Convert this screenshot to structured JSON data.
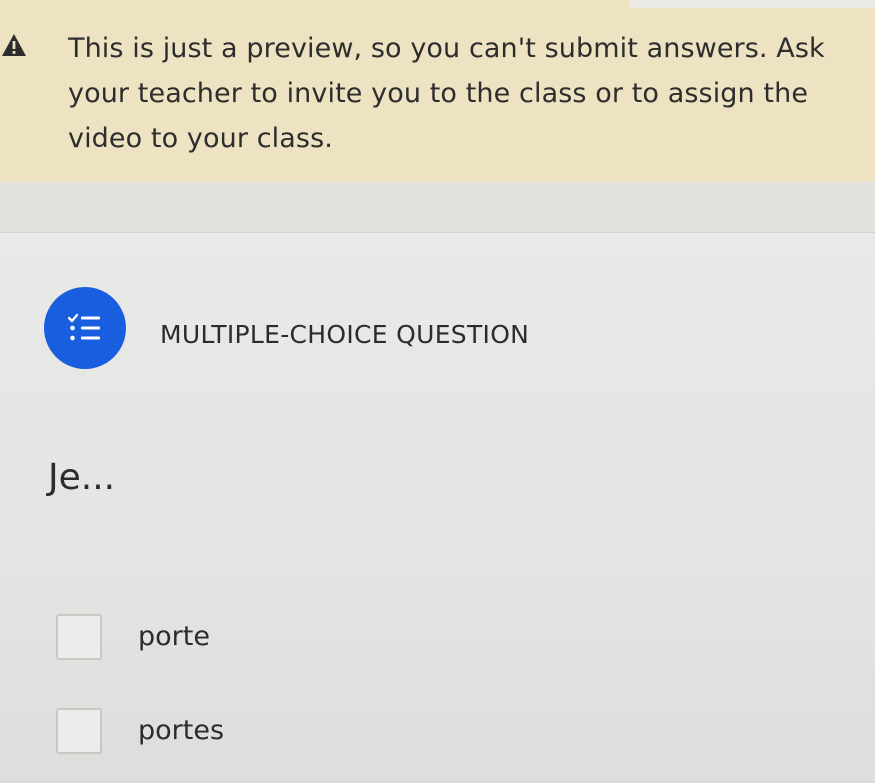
{
  "banner": {
    "icon": "warning-icon",
    "message": "This is just a preview, so you can't submit answers. Ask your teacher to invite you to the class or to assign the video to your class."
  },
  "question": {
    "icon": "checklist-icon",
    "type_label": "MULTIPLE-CHOICE QUESTION",
    "prompt": "Je...",
    "options": [
      {
        "label": "porte"
      },
      {
        "label": "portes"
      }
    ]
  },
  "colors": {
    "accent": "#1a5ee0",
    "banner_background": "#ede3c2"
  }
}
